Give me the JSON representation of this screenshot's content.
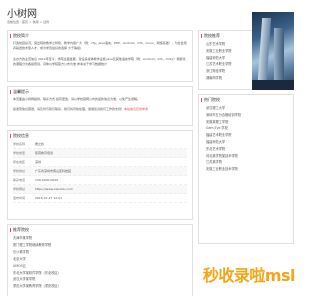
{
  "site": {
    "logo": "小树网"
  },
  "breadcrumb": [
    "当前位置",
    "首页",
    "信用",
    "证件"
  ],
  "school_intro": {
    "title": "院校简介",
    "text": "打造校园总况，突出院校教学之特色，教学内容广大（例：cfg，Java语言，PHP、Android、iOS、Linux、网络基础），为社会培养输送技术型人才，成为学员最好的选择 大于等级)",
    "text2": "主办方的主页信息 2012年至今，学院全面发展，建设多媒体教学设施 Java及其他语言学院（例：Android，iOS，Unity）规模化的课程分为各级培训，具体以学院官方公布为准 参考关于学习数据统计"
  },
  "notice": {
    "title": "温馨提示",
    "text1": "本页面由小树网提供，联系方式 如有更改，请以学校官网公布的最新信息为准，以免产生误解。",
    "text2": "如发现信息错误，请及时与我们联系，我们将尽快处理，谢谢您对我们工作的支持！",
    "highlight": "本站信息仅供参考"
  },
  "school_info": {
    "title": "院校信息",
    "rows": [
      {
        "k": "学校名称",
        "v": "鹰之岭"
      },
      {
        "k": "学校类型",
        "v": "民营教育培训"
      },
      {
        "k": "所在地区",
        "v": "深圳"
      },
      {
        "k": "学校地址",
        "v": "广东省深圳市南山区科技园"
      },
      {
        "k": "联系电话",
        "v": "139-0000-0000"
      },
      {
        "k": "学校网址",
        "v": "https://www.xiaoshu.com"
      },
      {
        "k": "发布时间",
        "v": "2016-07-27 12:01"
      }
    ]
  },
  "recommend": {
    "title": "推荐院校",
    "items": [
      "天津市某学院",
      "厦门理工学院继续教育学院",
      "长沙某学院",
      "北京大学",
      "UMOS云",
      "东北大学某软件学院（东北校区）",
      "武汉大学某学院",
      "重庆大学某教育学院（重庆校区）"
    ]
  },
  "sidebar_recommend": {
    "title": "院校推荐",
    "items": [
      "山东艺术学院",
      "安徽工业职业学院",
      "福建师范大学",
      "江苏艺术职业学院",
      "浙江财经学院",
      "湖南商学院"
    ]
  },
  "sidebar_hot": {
    "title": "热门院校",
    "items": [
      "武汉理工大学",
      "深圳市五分合格培训学校",
      "安徽某理工学院",
      "Gem Eye 学校",
      "福建艺术职业学院",
      "福建师范大学",
      "东北艺术学院",
      "河北某学院某技术学院",
      "江苏某学院",
      "安徽工业职业技术学院"
    ]
  },
  "watermark": {
    "text": "秒收录啦msl"
  }
}
